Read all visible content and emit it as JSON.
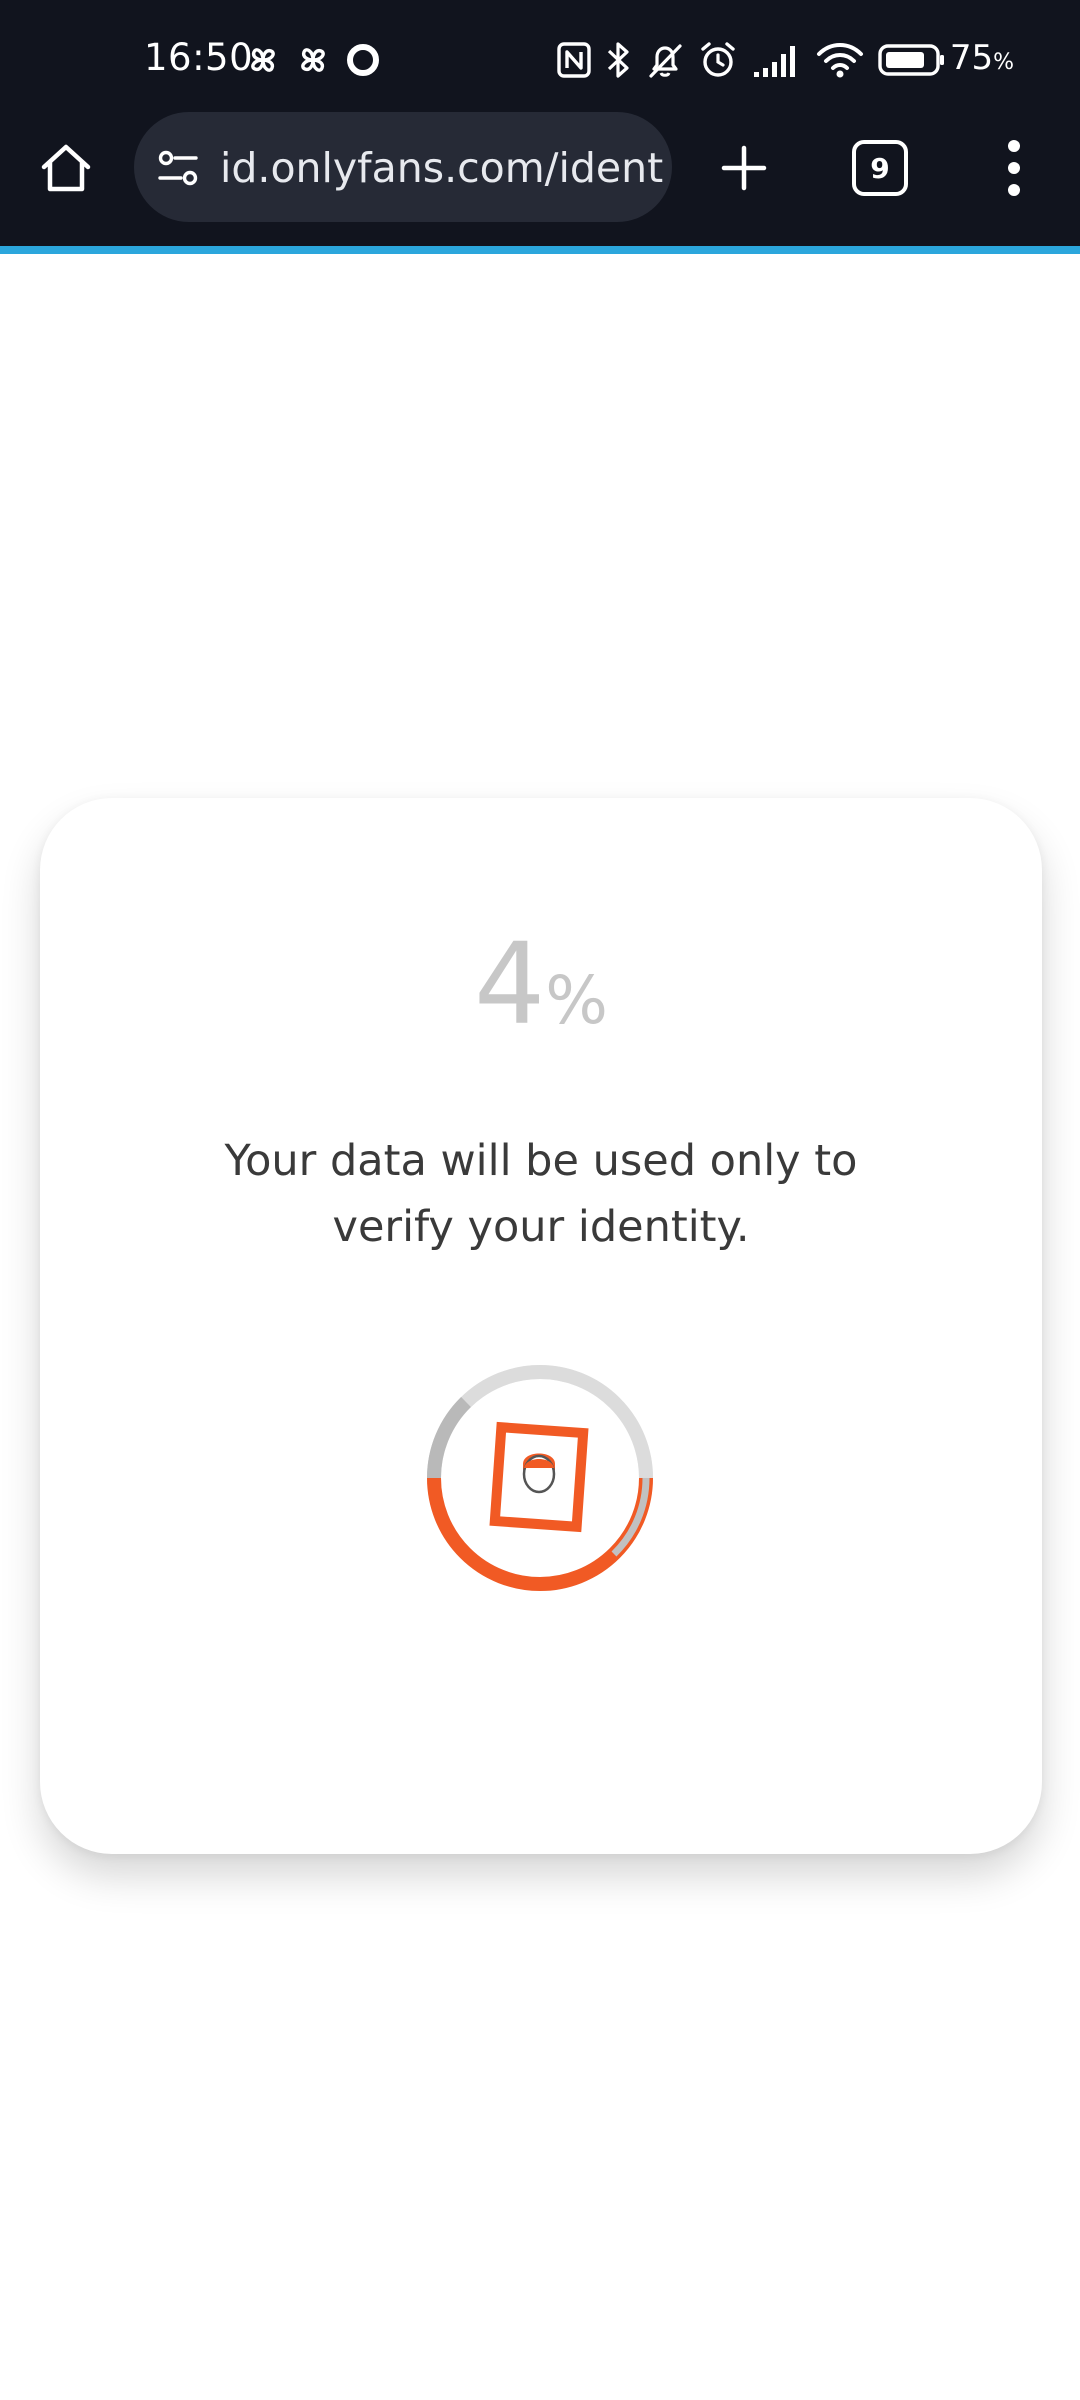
{
  "status_bar": {
    "time": "16:50",
    "battery_level": "75",
    "battery_unit": "%"
  },
  "browser": {
    "url": "id.onlyfans.com/ident",
    "tab_count": "9"
  },
  "verification": {
    "progress_value": "4",
    "progress_unit": "%",
    "notice": "Your data will be used only to verify your identity."
  },
  "colors": {
    "accent": "#2ba6dc",
    "loader_orange": "#f15a24",
    "toolbar_bg": "#11141e"
  }
}
